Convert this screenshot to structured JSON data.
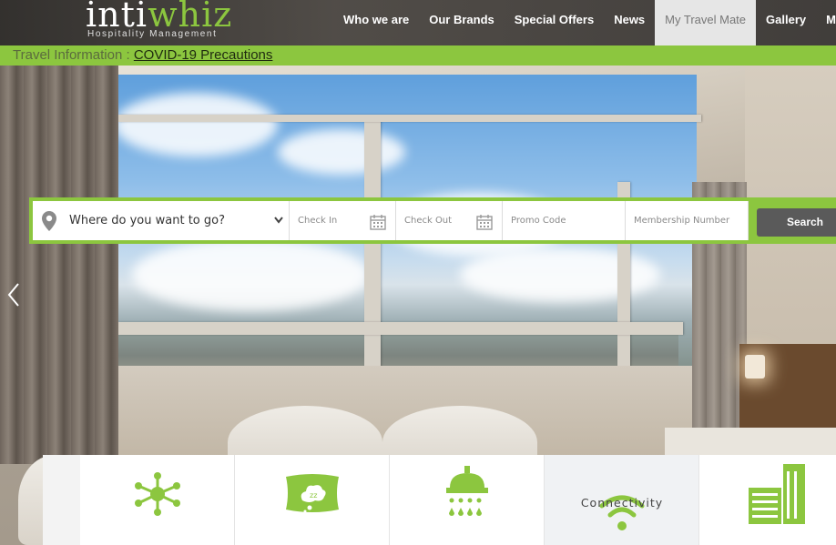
{
  "brand": {
    "name_part1": "inti",
    "name_part2": "whiz",
    "tagline": "Hospitality Management",
    "accent": "#8cc63f"
  },
  "nav": {
    "items": [
      {
        "label": "Who we are"
      },
      {
        "label": "Our Brands"
      },
      {
        "label": "Special Offers"
      },
      {
        "label": "News"
      },
      {
        "label": "My Travel Mate",
        "active": true
      },
      {
        "label": "Gallery"
      },
      {
        "label": "Memb"
      }
    ]
  },
  "infobar": {
    "label": "Travel Information : ",
    "link": "COVID-19 Precautions"
  },
  "booking": {
    "destination_placeholder": "Where do you want to go?",
    "check_in": "Check In",
    "check_out": "Check Out",
    "promo_code": "Promo Code",
    "membership_number": "Membership Number",
    "search_label": "Search"
  },
  "carousel": {
    "prev_icon": "chevron-left-icon"
  },
  "amenities": [
    {
      "icon": "network-icon",
      "label": ""
    },
    {
      "icon": "pillow-icon",
      "label": ""
    },
    {
      "icon": "shower-icon",
      "label": ""
    },
    {
      "icon": "wifi-icon",
      "label": "Connectivity"
    },
    {
      "icon": "building-icon",
      "label": ""
    }
  ]
}
